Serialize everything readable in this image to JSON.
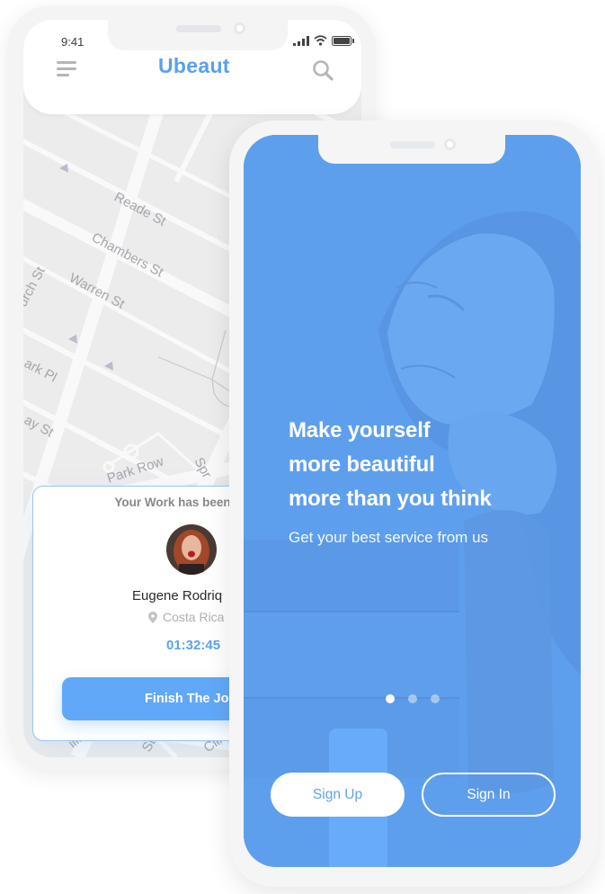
{
  "back_phone": {
    "status_bar": {
      "time": "9:41"
    },
    "header": {
      "logo": "Ubeaut",
      "menu_icon": "hamburger-menu-icon",
      "search_icon": "search-icon"
    },
    "map": {
      "street_labels": [
        "Reade St",
        "Chambers St",
        "Warren St",
        "urch St",
        "ark Pl",
        "ay St",
        "Park Row",
        "Spr",
        "illiar",
        "St",
        "Clin"
      ]
    },
    "work_card": {
      "title": "Your Work has been",
      "name": "Eugene Rodriq",
      "location": "Costa Rica",
      "location_icon": "map-pin-icon",
      "timer": "01:32:45",
      "button": "Finish The Jo"
    }
  },
  "front_phone": {
    "headline": [
      "Make yourself",
      "more beautiful",
      "more than you think"
    ],
    "subline": "Get your best service from us",
    "carousel": {
      "count": 3,
      "active_index": 0
    },
    "buttons": {
      "sign_up": "Sign Up",
      "sign_in": "Sign In"
    }
  },
  "colors": {
    "brand_blue": "#5a9ff0",
    "onboarding_bg": "#5e9fed",
    "button_blue": "#62a8f8",
    "timer_blue": "#5aa2f5"
  }
}
